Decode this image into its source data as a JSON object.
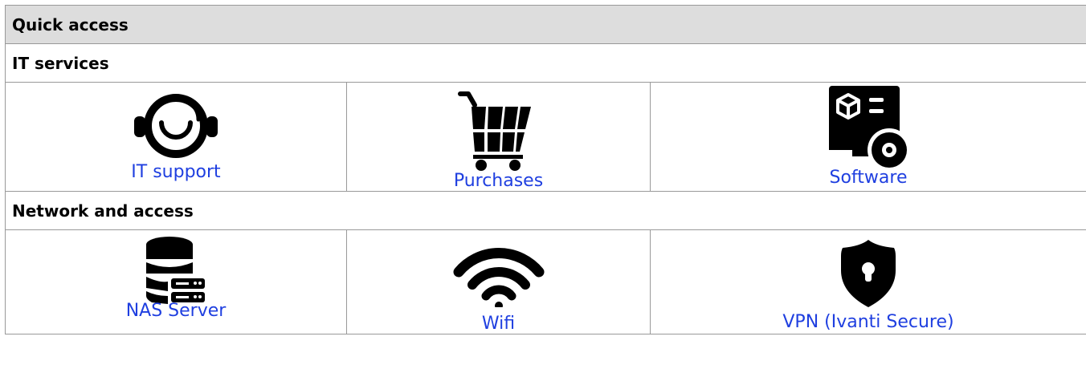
{
  "title": "Quick access",
  "sections": [
    {
      "heading": "IT services",
      "items": [
        {
          "label": "IT support",
          "icon": "headset-icon"
        },
        {
          "label": "Purchases",
          "icon": "shopping-cart-icon"
        },
        {
          "label": "Software",
          "icon": "software-monitor-icon"
        }
      ]
    },
    {
      "heading": "Network and access",
      "items": [
        {
          "label": "NAS Server",
          "icon": "server-database-icon"
        },
        {
          "label": "Wifi",
          "icon": "wifi-icon"
        },
        {
          "label": "VPN (Ivanti Secure)",
          "icon": "shield-lock-icon"
        }
      ]
    }
  ],
  "colors": {
    "header_bg": "#dddddd",
    "border": "#999999",
    "link": "#1f3fe0",
    "icon": "#000000"
  }
}
